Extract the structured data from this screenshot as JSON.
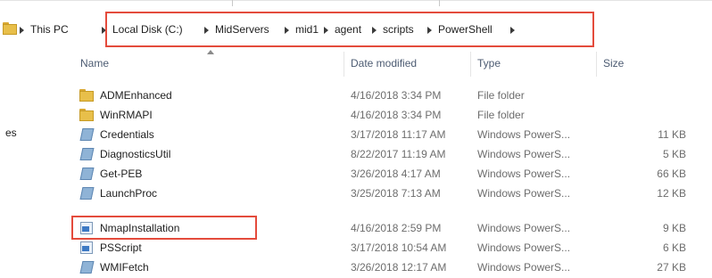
{
  "breadcrumb": [
    "This PC",
    "Local Disk (C:)",
    "MidServers",
    "mid1",
    "agent",
    "scripts",
    "PowerShell"
  ],
  "nav_pane": {
    "partial_label": "es"
  },
  "columns": {
    "name": "Name",
    "date": "Date modified",
    "type": "Type",
    "size": "Size"
  },
  "rows": [
    {
      "name": "ADMEnhanced",
      "date": "4/16/2018 3:34 PM",
      "type": "File folder",
      "size": "",
      "icon": "folder-icon"
    },
    {
      "name": "WinRMAPI",
      "date": "4/16/2018 3:34 PM",
      "type": "File folder",
      "size": "",
      "icon": "folder-icon"
    },
    {
      "name": "Credentials",
      "date": "3/17/2018 11:17 AM",
      "type": "Windows PowerS...",
      "size": "11 KB",
      "icon": "powershell-file-icon"
    },
    {
      "name": "DiagnosticsUtil",
      "date": "8/22/2017 11:19 AM",
      "type": "Windows PowerS...",
      "size": "5 KB",
      "icon": "powershell-file-icon"
    },
    {
      "name": "Get-PEB",
      "date": "3/26/2018 4:17 AM",
      "type": "Windows PowerS...",
      "size": "66 KB",
      "icon": "powershell-file-icon"
    },
    {
      "name": "LaunchProc",
      "date": "3/25/2018 7:13 AM",
      "type": "Windows PowerS...",
      "size": "12 KB",
      "icon": "powershell-file-icon"
    },
    {
      "name": "NmapInstallation",
      "date": "4/16/2018 2:59 PM",
      "type": "Windows PowerS...",
      "size": "9 KB",
      "icon": "powershell-script-icon"
    },
    {
      "name": "PSScript",
      "date": "3/17/2018 10:54 AM",
      "type": "Windows PowerS...",
      "size": "6 KB",
      "icon": "powershell-script-icon"
    },
    {
      "name": "WMIFetch",
      "date": "3/26/2018 12:17 AM",
      "type": "Windows PowerS...",
      "size": "27 KB",
      "icon": "powershell-file-icon"
    }
  ],
  "colors": {
    "highlight": "#e44b3c",
    "folder": "#e8bf4a",
    "header_text": "#4c5b72"
  }
}
